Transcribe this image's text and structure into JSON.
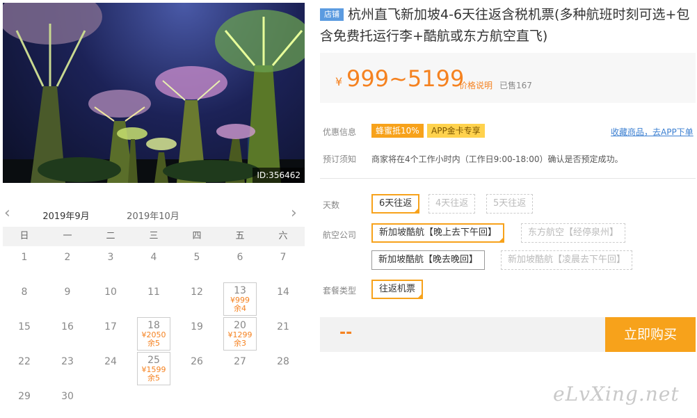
{
  "photo": {
    "id_label": "ID:356462"
  },
  "calendar": {
    "months": [
      "2019年9月",
      "2019年10月"
    ],
    "weekdays": [
      "日",
      "一",
      "二",
      "三",
      "四",
      "五",
      "六"
    ],
    "weeks": [
      [
        {
          "d": "1"
        },
        {
          "d": "2"
        },
        {
          "d": "3"
        },
        {
          "d": "4"
        },
        {
          "d": "5"
        },
        {
          "d": "6"
        },
        {
          "d": "7"
        }
      ],
      [
        {
          "d": "8"
        },
        {
          "d": "9"
        },
        {
          "d": "10"
        },
        {
          "d": "11"
        },
        {
          "d": "12"
        },
        {
          "d": "13",
          "price": "¥999",
          "stock": "余4"
        },
        {
          "d": "14"
        }
      ],
      [
        {
          "d": "15"
        },
        {
          "d": "16"
        },
        {
          "d": "17"
        },
        {
          "d": "18",
          "price": "¥2050",
          "stock": "余5"
        },
        {
          "d": "19"
        },
        {
          "d": "20",
          "price": "¥1299",
          "stock": "余3"
        },
        {
          "d": "21"
        }
      ],
      [
        {
          "d": "22"
        },
        {
          "d": "23"
        },
        {
          "d": "24"
        },
        {
          "d": "25",
          "price": "¥1599",
          "stock": "余5"
        },
        {
          "d": "26"
        },
        {
          "d": "27"
        },
        {
          "d": "28"
        }
      ],
      [
        {
          "d": "29"
        },
        {
          "d": "30"
        },
        {
          "d": ""
        },
        {
          "d": ""
        },
        {
          "d": ""
        },
        {
          "d": ""
        },
        {
          "d": ""
        }
      ]
    ]
  },
  "product": {
    "shop_tag": "店铺",
    "title": "杭州直飞新加坡4-6天往返含税机票(多种航班时刻可选+包含免费托运行李+酷航或东方航空直飞)",
    "currency": "¥",
    "price_range": "999~5199",
    "price_explain": "价格说明",
    "sold": "已售167"
  },
  "promo": {
    "label": "优惠信息",
    "badge1": "蜂蜜抵10%",
    "badge2": "APP金卡专享",
    "collect_link": "收藏商品，去APP下单"
  },
  "booking": {
    "label": "预订须知",
    "text": "商家将在4个工作小时内（工作日9:00-18:00）确认是否预定成功。"
  },
  "options": {
    "days_label": "天数",
    "days": [
      "6天往返",
      "4天往返",
      "5天往返"
    ],
    "airline_label": "航空公司",
    "airlines": [
      "新加坡酷航【晚上去下午回】",
      "东方航空【经停泉州】",
      "新加坡酷航【晚去晚回】",
      "新加坡酷航【凌晨去下午回】"
    ],
    "package_label": "套餐类型",
    "packages": [
      "往返机票"
    ]
  },
  "buy": {
    "total": "--",
    "button": "立即购买"
  },
  "watermark": "eLvXing.net",
  "colors": {
    "accent": "#f7a21b",
    "price": "#f58220",
    "link": "#3b7fd1"
  }
}
